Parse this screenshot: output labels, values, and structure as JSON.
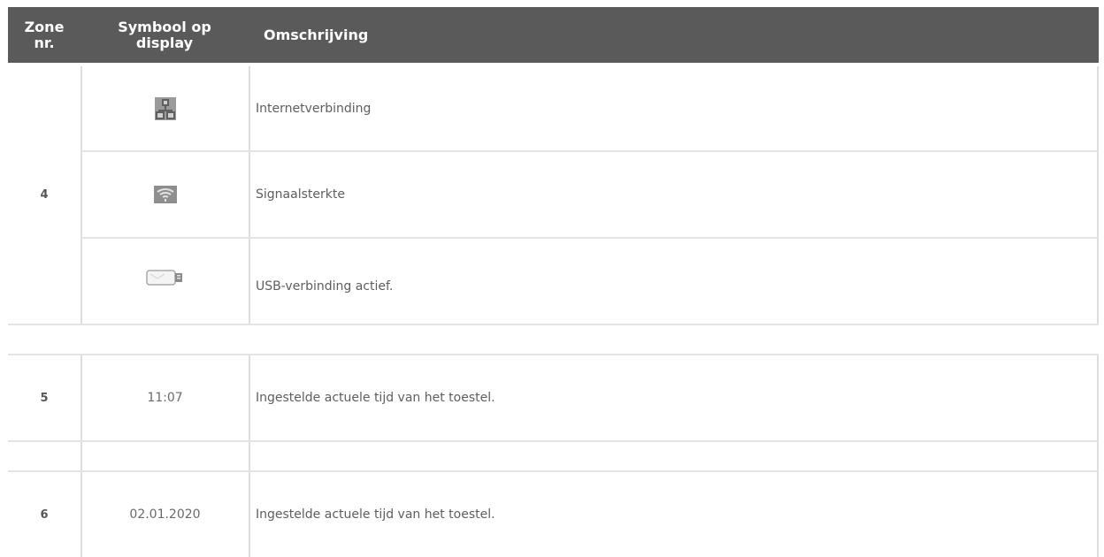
{
  "table": {
    "headers": {
      "zone": "Zone\nnr.",
      "symbol": "Symbool op\ndisplay",
      "description": "Omschrijving"
    },
    "rows": [
      {
        "zone": "4",
        "symbol_icon": "network-icon",
        "description": "Internetverbinding"
      },
      {
        "zone": "",
        "symbol_icon": "wifi-signal-icon",
        "description": "Signaalsterkte"
      },
      {
        "zone": "",
        "symbol_icon": "usb-stick-icon",
        "description": "USB-verbinding actief."
      },
      {
        "zone": "5",
        "symbol": "11:07",
        "description": "Ingestelde actuele tijd van het toestel."
      },
      {
        "zone": "6",
        "symbol": "02.01.2020",
        "description": "Ingestelde actuele tijd van het toestel."
      }
    ]
  }
}
